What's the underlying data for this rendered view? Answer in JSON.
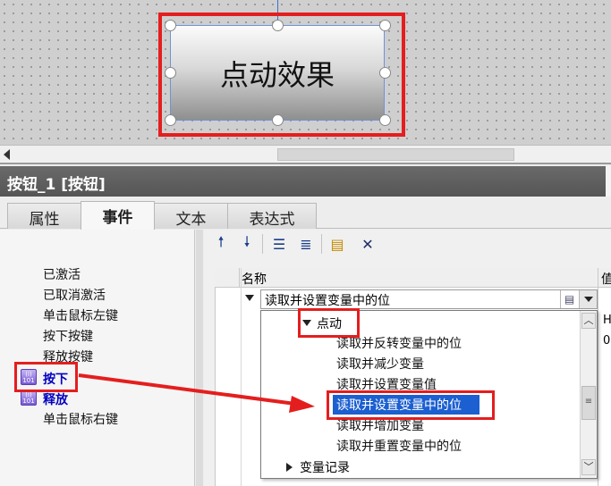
{
  "canvas": {
    "demo_button_label": "点动效果"
  },
  "props": {
    "title": "按钮_1 [按钮]"
  },
  "tabs": [
    "属性",
    "事件",
    "文本",
    "表达式"
  ],
  "events": [
    "已激活",
    "已取消激活",
    "单击鼠标左键",
    "按下按键",
    "释放按键",
    "按下",
    "释放",
    "单击鼠标右键"
  ],
  "toolbar": {
    "icons": [
      "move-up-icon",
      "move-down-icon",
      "collapse-all-icon",
      "expand-all-icon",
      "script-icon",
      "delete-icon"
    ]
  },
  "grid": {
    "col_name": "名称",
    "col_value": "值",
    "selected_function": "读取并设置变量中的位",
    "value_cells": [
      "H",
      "0"
    ]
  },
  "popup": {
    "group": "点动",
    "items": [
      "读取并反转变量中的位",
      "读取并减少变量",
      "读取并设置变量值",
      "读取并设置变量中的位",
      "读取并增加变量",
      "读取并重置变量中的位"
    ],
    "next_group": "变量记录"
  },
  "colors": {
    "annotation_red": "#e41e1e",
    "selection_blue": "#1c5fd0"
  }
}
